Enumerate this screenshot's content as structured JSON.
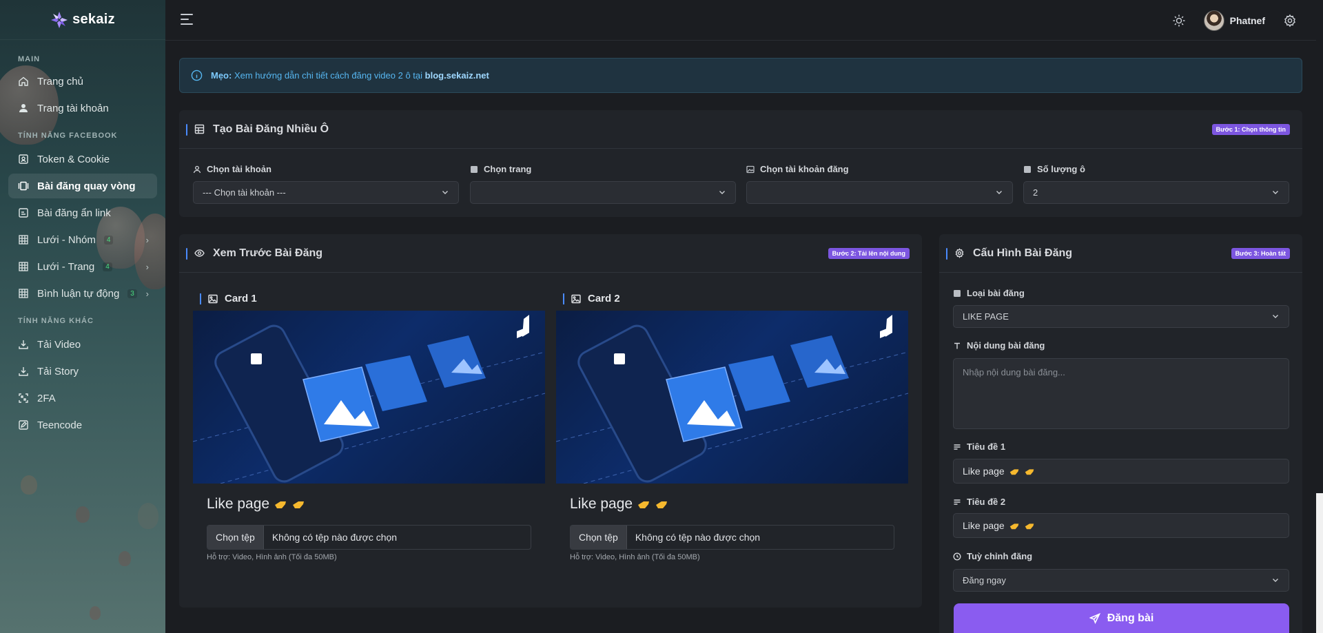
{
  "brand": {
    "name": "sekaiz"
  },
  "sidebar": {
    "sections": {
      "main": "MAIN",
      "facebook": "TÍNH NĂNG FACEBOOK",
      "other": "TÍNH NĂNG KHÁC"
    },
    "items": [
      {
        "label": "Trang chủ",
        "icon": "home-icon"
      },
      {
        "label": "Trang tài khoản",
        "icon": "user-icon"
      },
      {
        "label": "Token & Cookie",
        "icon": "id-card-icon"
      },
      {
        "label": "Bài đăng quay vòng",
        "icon": "carousel-icon",
        "active": true
      },
      {
        "label": "Bài đăng ẩn link",
        "icon": "image-link-icon"
      },
      {
        "label": "Lưới - Nhóm",
        "icon": "grid-icon",
        "count": "4"
      },
      {
        "label": "Lưới - Trang",
        "icon": "grid-icon",
        "count": "4"
      },
      {
        "label": "Bình luận tự động",
        "icon": "grid-icon",
        "count": "3"
      },
      {
        "label": "Tải Video",
        "icon": "download-icon"
      },
      {
        "label": "Tải Story",
        "icon": "download-icon"
      },
      {
        "label": "2FA",
        "icon": "scan-icon"
      },
      {
        "label": "Teencode",
        "icon": "edit-square-icon"
      }
    ]
  },
  "topbar": {
    "username": "Phatnef"
  },
  "alert": {
    "prefix": "Mẹo:",
    "text": " Xem hướng dẫn chi tiết cách đăng video 2 ô tại ",
    "link": "blog.sekaiz.net"
  },
  "create": {
    "title": "Tạo Bài Đăng Nhiều Ô",
    "badge": "Bước 1: Chọn thông tin",
    "fields": [
      {
        "label": "Chọn tài khoản",
        "value": "--- Chọn tài khoản ---"
      },
      {
        "label": "Chọn trang",
        "value": ""
      },
      {
        "label": "Chọn tài khoản đăng",
        "value": ""
      },
      {
        "label": "Số lượng ô",
        "value": "2"
      }
    ]
  },
  "preview": {
    "title": "Xem Trước Bài Đăng",
    "badge": "Bước 2: Tải lên nội dung",
    "cards": [
      {
        "title": "Card 1",
        "post_title": "Like page",
        "file_button": "Chọn tệp",
        "file_text": "Không có tệp nào được chọn",
        "hint": "Hỗ trợ: Video, Hình ảnh (Tối đa 50MB)"
      },
      {
        "title": "Card 2",
        "post_title": "Like page",
        "file_button": "Chọn tệp",
        "file_text": "Không có tệp nào được chọn",
        "hint": "Hỗ trợ: Video, Hình ảnh (Tối đa 50MB)"
      }
    ]
  },
  "config": {
    "title": "Cấu Hình Bài Đăng",
    "badge": "Bước 3: Hoàn tất",
    "post_type_label": "Loại bài đăng",
    "post_type_value": "LIKE PAGE",
    "content_label": "Nội dung bài đăng",
    "content_placeholder": "Nhập nội dung bài đăng...",
    "title1_label": "Tiêu đề 1",
    "title1_value": "Like page",
    "title2_label": "Tiêu đề 2",
    "title2_value": "Like page",
    "schedule_label": "Tuỳ chỉnh đăng",
    "schedule_value": "Đăng ngay",
    "submit_label": "Đăng bài"
  }
}
